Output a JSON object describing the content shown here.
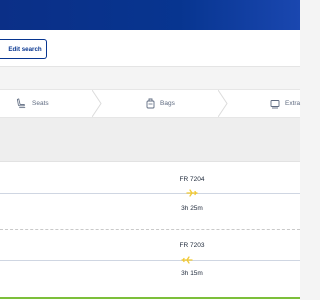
{
  "header": {
    "edit_search_label": "Edit search"
  },
  "steps": [
    {
      "label": "Seats",
      "icon": "seat-icon"
    },
    {
      "label": "Bags",
      "icon": "bag-icon"
    },
    {
      "label": "Extra",
      "icon": "extras-icon"
    }
  ],
  "flights": [
    {
      "flight_number": "FR 7204",
      "duration": "3h 25m"
    },
    {
      "flight_number": "FR 7203",
      "duration": "3h 15m"
    }
  ],
  "colors": {
    "brand_blue": "#073590",
    "accent_yellow": "#f1c933",
    "progress_green": "#7cbf3a"
  }
}
